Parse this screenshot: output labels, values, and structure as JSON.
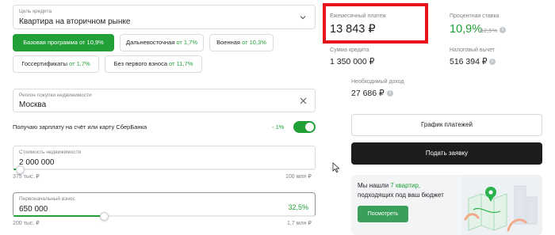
{
  "form": {
    "goal": {
      "label": "Цель кредита",
      "value": "Квартира на вторичном рынке"
    },
    "programs": [
      {
        "name": "Базовая программа от",
        "rate": "10,9%",
        "active": true
      },
      {
        "name": "Дальневосточная",
        "rate": "от 1,7%",
        "active": false
      },
      {
        "name": "Военная",
        "rate": "от 10,3%",
        "active": false
      },
      {
        "name": "Госсертификаты",
        "rate": "от 1,7%",
        "active": false
      },
      {
        "name": "Без первого взноса",
        "rate": "от 11,7%",
        "active": false
      }
    ],
    "region": {
      "label": "Регион покупки недвижимости",
      "value": "Москва"
    },
    "salary": {
      "text": "Получаю зарплату на счёт или карту СберБанка",
      "discount": "- 1%",
      "enabled": true
    },
    "property_cost": {
      "label": "Стоимость недвижимости",
      "value": "2 000 000",
      "min": "375 тыс. ₽",
      "max": "100 млн ₽",
      "position": 0.02
    },
    "down_payment": {
      "label": "Первоначальный взнос",
      "value": "650 000",
      "percent": "32,5%",
      "min": "200 тыс. ₽",
      "max": "1,7 млн ₽",
      "position": 0.3
    }
  },
  "results": {
    "monthly_label": "Ежемесячный платеж",
    "monthly_value": "13 843 ₽",
    "rate_label": "Процентная ставка",
    "rate_value": "10,9%",
    "rate_old": "12,5%",
    "credit_label": "Сумма кредита",
    "credit_value": "1 350 000 ₽",
    "tax_label": "Налоговый вычет",
    "tax_value": "516 394 ₽",
    "income_label": "Необходимый доход",
    "income_value": "27 686 ₽",
    "schedule_button": "График платежей",
    "apply_button": "Подать заявку"
  },
  "promo": {
    "line1_prefix": "Мы нашли",
    "line1_highlight": "7 квартир,",
    "line2": "подходящих под ваш бюджет",
    "button": "Посмотреть"
  },
  "colors": {
    "accent": "#21a038",
    "highlight_frame": "#e8121a",
    "dark_button": "#1d1d1f"
  }
}
